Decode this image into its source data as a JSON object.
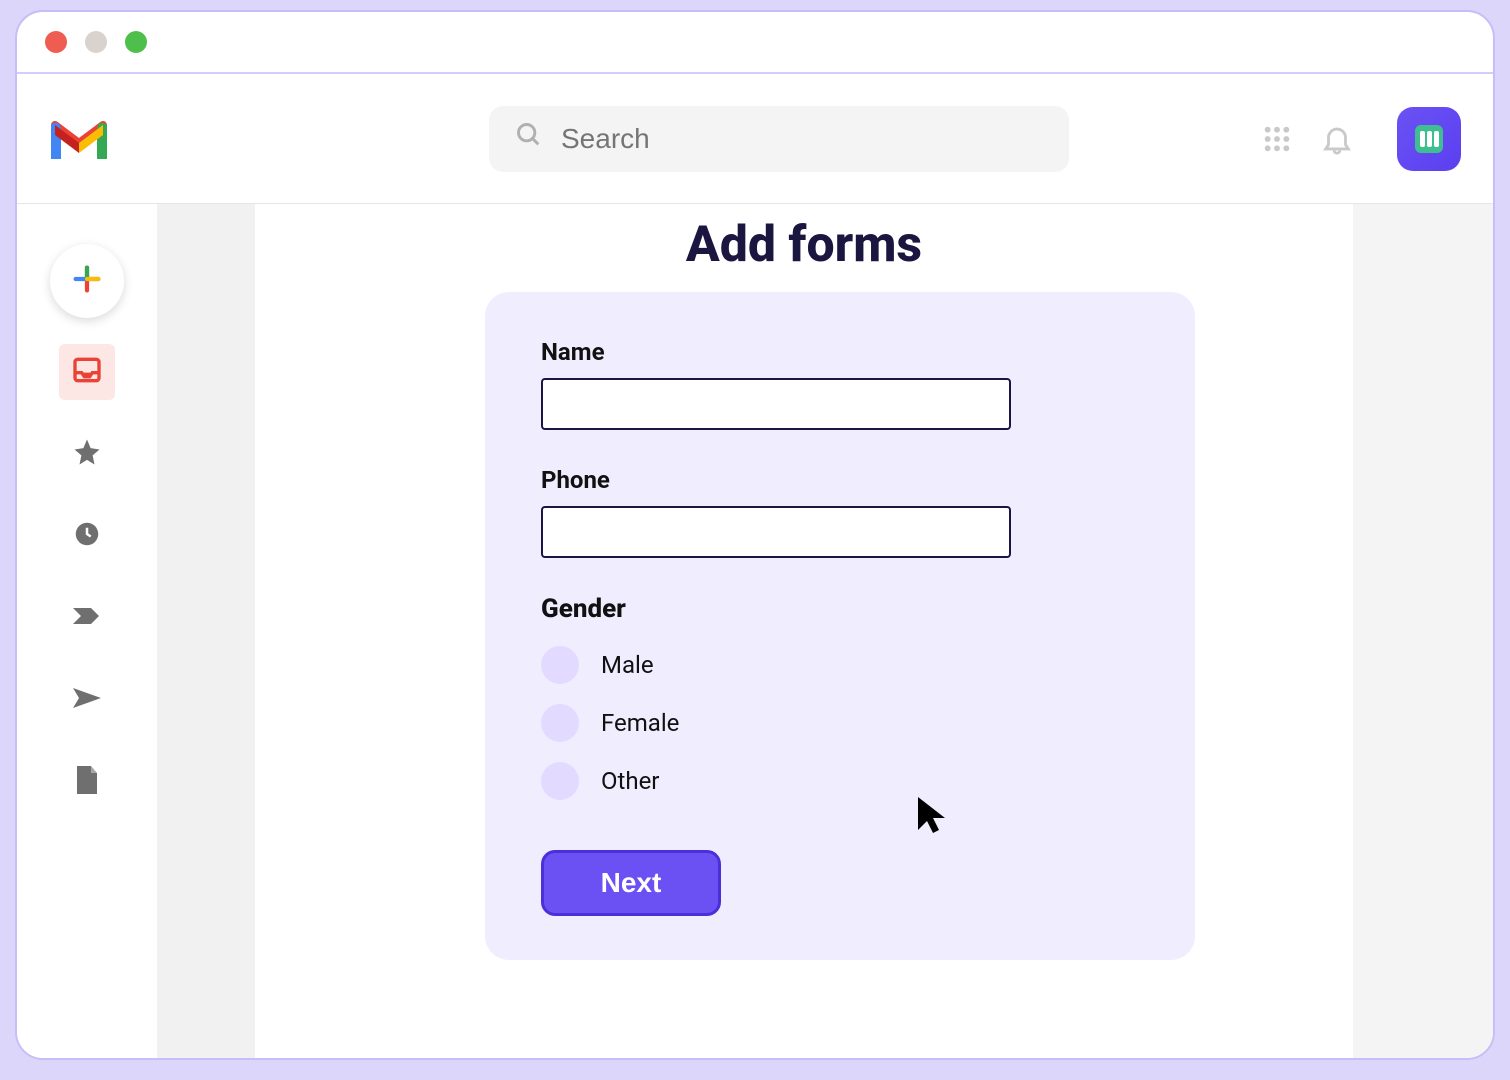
{
  "header": {
    "search_placeholder": "Search"
  },
  "sidebar": {
    "items": [
      {
        "name": "inbox"
      },
      {
        "name": "starred"
      },
      {
        "name": "snoozed"
      },
      {
        "name": "important"
      },
      {
        "name": "sent"
      },
      {
        "name": "drafts"
      }
    ]
  },
  "page": {
    "title": "Add forms"
  },
  "form": {
    "name_label": "Name",
    "name_value": "",
    "phone_label": "Phone",
    "phone_value": "",
    "gender_label": "Gender",
    "gender_options": [
      "Male",
      "Female",
      "Other"
    ],
    "next_label": "Next"
  }
}
